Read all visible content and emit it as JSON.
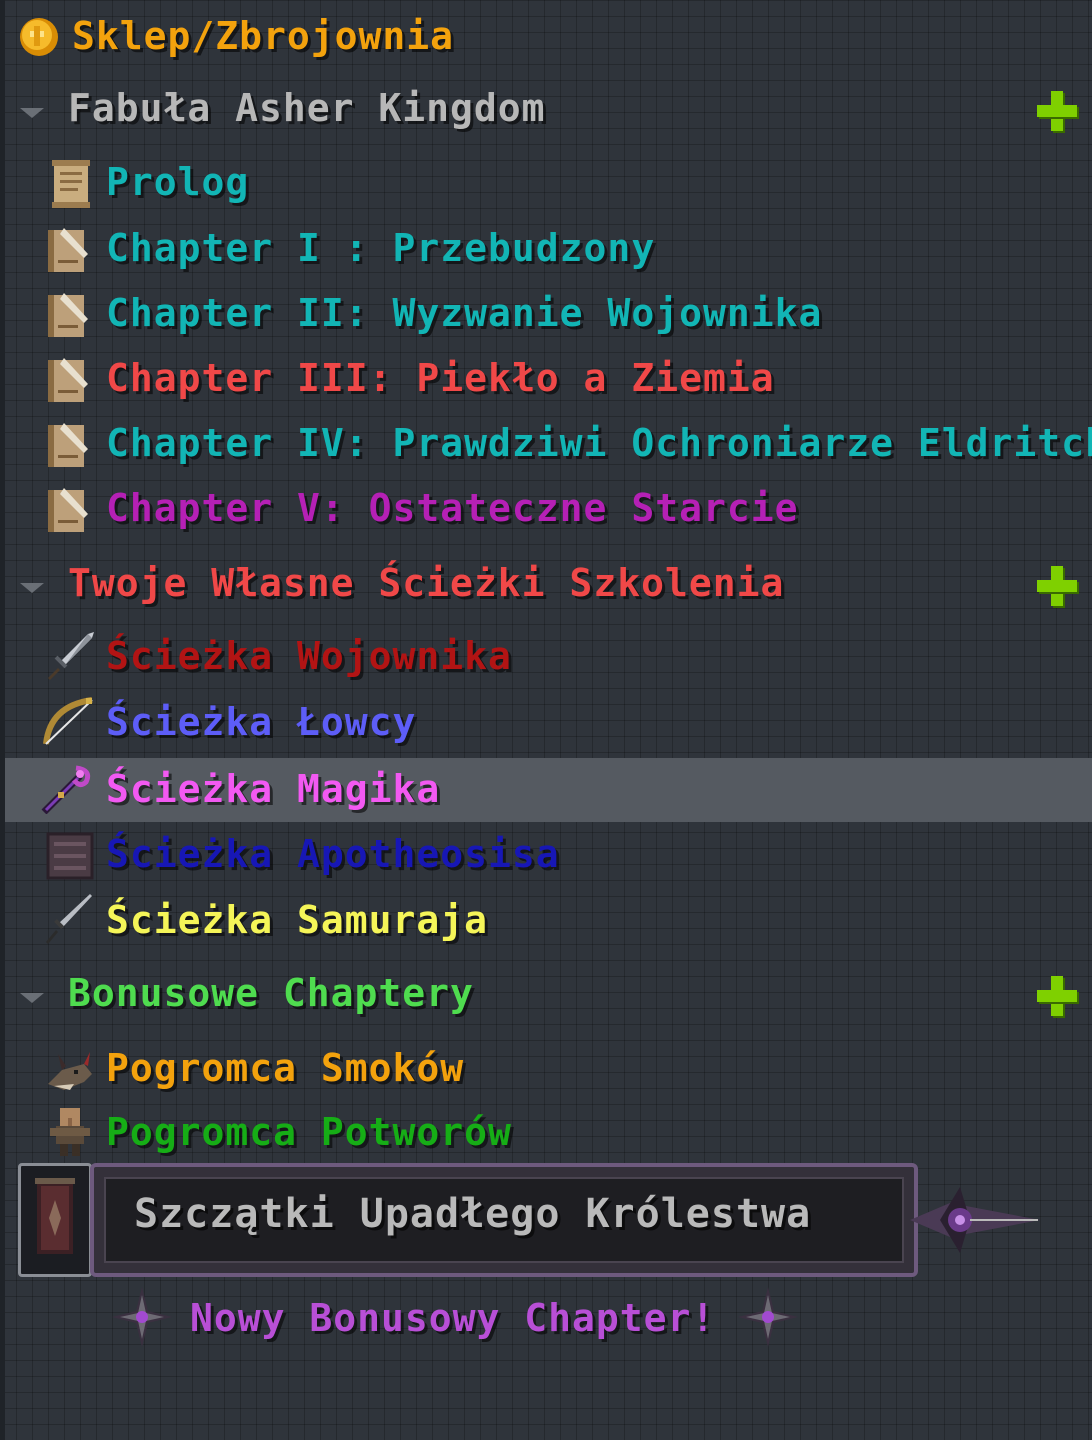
{
  "header": {
    "title": "Sklep/Zbrojownia",
    "title_color": "#f3a20d",
    "icon": "gold-coin-icon"
  },
  "sections": [
    {
      "title": "Fabuła Asher Kingdom",
      "color": "#b7b7b7",
      "items": [
        {
          "label": "Prolog",
          "color": "#12b5b5",
          "icon": "scroll-icon"
        },
        {
          "label": "Chapter I : Przebudzony",
          "color": "#12b5b5",
          "icon": "book-quill-icon"
        },
        {
          "label": "Chapter II: Wyzwanie Wojownika",
          "color": "#12b5b5",
          "icon": "book-quill-icon"
        },
        {
          "label": "Chapter III: Piekło a Ziemia",
          "color": "#f04848",
          "icon": "book-quill-icon"
        },
        {
          "label": "Chapter IV: Prawdziwi Ochroniarze Eldritcha",
          "color": "#12b5b5",
          "icon": "book-quill-icon"
        },
        {
          "label": "Chapter V: Ostateczne Starcie",
          "color": "#b520b5",
          "icon": "book-quill-icon"
        }
      ]
    },
    {
      "title": "Twoje Własne Ścieżki Szkolenia",
      "color": "#f04848",
      "items": [
        {
          "label": "Ścieżka Wojownika",
          "color": "#b21414",
          "icon": "sword-icon"
        },
        {
          "label": "Ścieżka Łowcy",
          "color": "#5d5df7",
          "icon": "bow-icon"
        },
        {
          "label": "Ścieżka Magika",
          "color": "#f259f2",
          "icon": "staff-icon"
        },
        {
          "label": "Ścieżka Apotheosisa",
          "color": "#1717b5",
          "icon": "crate-icon"
        },
        {
          "label": "Ścieżka Samuraja",
          "color": "#f5f558",
          "icon": "katana-icon"
        }
      ]
    },
    {
      "title": "Bonusowe Chaptery",
      "color": "#4fdc4f",
      "items": [
        {
          "label": "Pogromca Smoków",
          "color": "#f3a20d",
          "icon": "dragon-skull-icon"
        },
        {
          "label": "Pogromca Potworów",
          "color": "#16ad16",
          "icon": "villager-icon"
        }
      ]
    }
  ],
  "toast": {
    "title": "Szczątki Upadłego Królestwa",
    "subtitle": "Nowy Bonusowy Chapter!",
    "subtitle_color": "#b84fd6",
    "icon": "banner-icon"
  },
  "highlighted_item": "Ścieżka Magika",
  "add_icon_color": "#7fd000"
}
